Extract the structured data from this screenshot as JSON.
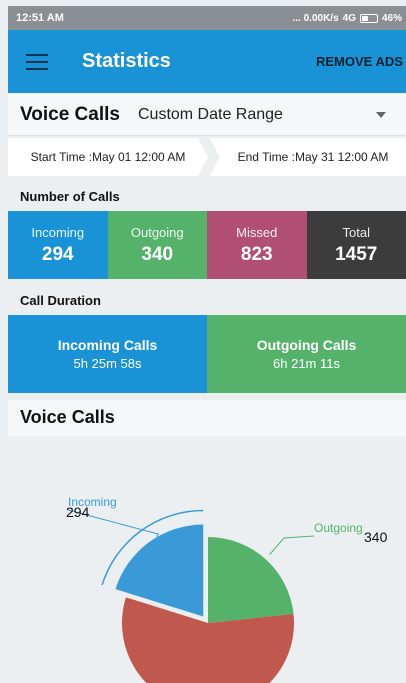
{
  "status_bar": {
    "time": "12:51 AM",
    "indicators": "... 0.00K/s",
    "network": "4G",
    "battery": "46%"
  },
  "app_bar": {
    "title": "Statistics",
    "remove_ads": "REMOVE ADS",
    "menu_icon": "hamburger-menu-icon"
  },
  "selector": {
    "type": "Voice Calls",
    "range": "Custom Date Range"
  },
  "time_range": {
    "start": "Start Time :May 01 12:00 AM",
    "end": "End Time :May 31 12:00 AM"
  },
  "number_of_calls": {
    "heading": "Number of Calls",
    "items": [
      {
        "label": "Incoming",
        "value": "294",
        "color": "#1a93d6"
      },
      {
        "label": "Outgoing",
        "value": "340",
        "color": "#55b26b"
      },
      {
        "label": "Missed",
        "value": "823",
        "color": "#b04f73"
      },
      {
        "label": "Total",
        "value": "1457",
        "color": "#3c3c3c"
      }
    ]
  },
  "call_duration": {
    "heading": "Call Duration",
    "items": [
      {
        "label": "Incoming Calls",
        "value": "5h 25m 58s",
        "color": "#1a93d6"
      },
      {
        "label": "Outgoing Calls",
        "value": "6h 21m 11s",
        "color": "#55b26b"
      }
    ]
  },
  "chart_section": {
    "title": "Voice Calls"
  },
  "chart_data": {
    "type": "pie",
    "slices": [
      {
        "label": "Incoming",
        "value": 294,
        "color": "#3a9ad8"
      },
      {
        "label": "Outgoing",
        "value": 340,
        "color": "#55b26b"
      },
      {
        "label": "",
        "value": 823,
        "color": "#c0584d"
      }
    ]
  }
}
